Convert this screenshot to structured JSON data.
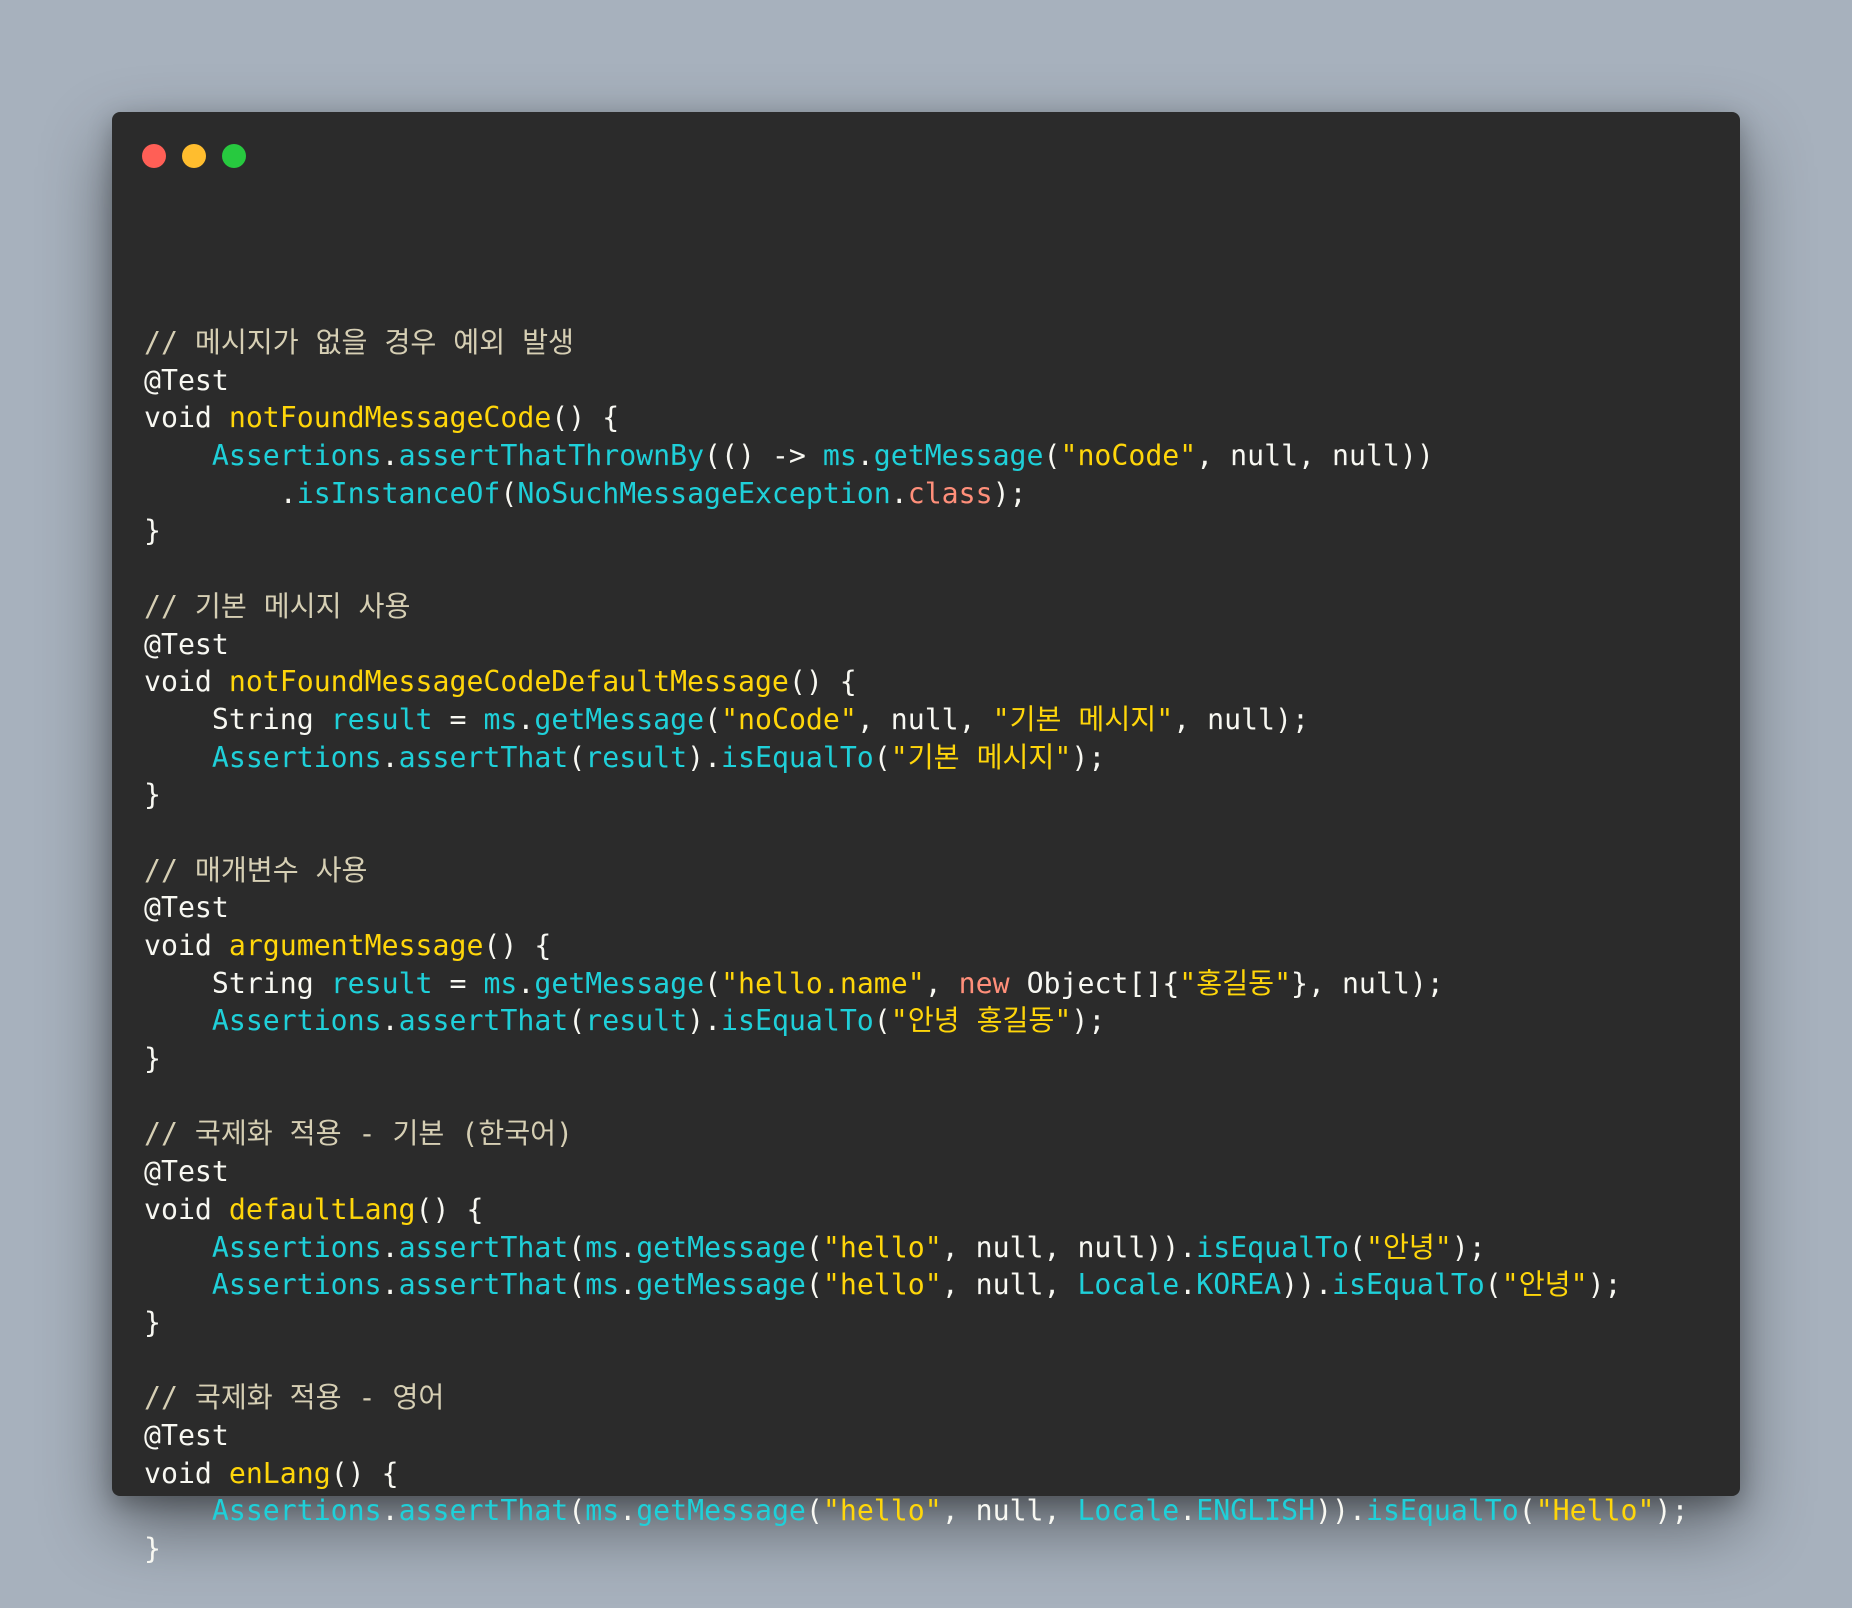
{
  "window": {
    "controls": [
      {
        "name": "close",
        "color": "#ff5f56"
      },
      {
        "name": "minimize",
        "color": "#ffbd2e"
      },
      {
        "name": "maximize",
        "color": "#27c93f"
      }
    ]
  },
  "colors": {
    "background": "#a7b1bd",
    "editor": "#2b2b2b",
    "comment": "#d6cfb4",
    "plain": "#f8f8f2",
    "function": "#ffd60a",
    "identifier": "#1fd0d9",
    "string": "#ffd60a",
    "keyword": "#ff8f7a"
  },
  "code": {
    "lines": [
      [
        {
          "t": "// 메시지가 없을 경우 예외 발생",
          "c": "comment"
        }
      ],
      [
        {
          "t": "@Test",
          "c": "plain"
        }
      ],
      [
        {
          "t": "void ",
          "c": "plain"
        },
        {
          "t": "notFoundMessageCode",
          "c": "fn"
        },
        {
          "t": "() {",
          "c": "plain"
        }
      ],
      [
        {
          "t": "    ",
          "c": "plain"
        },
        {
          "t": "Assertions",
          "c": "ident"
        },
        {
          "t": ".",
          "c": "plain"
        },
        {
          "t": "assertThatThrownBy",
          "c": "ident"
        },
        {
          "t": "(() -> ",
          "c": "plain"
        },
        {
          "t": "ms",
          "c": "ident"
        },
        {
          "t": ".",
          "c": "plain"
        },
        {
          "t": "getMessage",
          "c": "ident"
        },
        {
          "t": "(",
          "c": "plain"
        },
        {
          "t": "\"noCode\"",
          "c": "str"
        },
        {
          "t": ", null, null))",
          "c": "plain"
        }
      ],
      [
        {
          "t": "        .",
          "c": "plain"
        },
        {
          "t": "isInstanceOf",
          "c": "ident"
        },
        {
          "t": "(",
          "c": "plain"
        },
        {
          "t": "NoSuchMessageException",
          "c": "ident"
        },
        {
          "t": ".",
          "c": "plain"
        },
        {
          "t": "class",
          "c": "kw"
        },
        {
          "t": ");",
          "c": "plain"
        }
      ],
      [
        {
          "t": "}",
          "c": "plain"
        }
      ],
      [],
      [
        {
          "t": "// 기본 메시지 사용",
          "c": "comment"
        }
      ],
      [
        {
          "t": "@Test",
          "c": "plain"
        }
      ],
      [
        {
          "t": "void ",
          "c": "plain"
        },
        {
          "t": "notFoundMessageCodeDefaultMessage",
          "c": "fn"
        },
        {
          "t": "() {",
          "c": "plain"
        }
      ],
      [
        {
          "t": "    String ",
          "c": "plain"
        },
        {
          "t": "result",
          "c": "ident"
        },
        {
          "t": " = ",
          "c": "plain"
        },
        {
          "t": "ms",
          "c": "ident"
        },
        {
          "t": ".",
          "c": "plain"
        },
        {
          "t": "getMessage",
          "c": "ident"
        },
        {
          "t": "(",
          "c": "plain"
        },
        {
          "t": "\"noCode\"",
          "c": "str"
        },
        {
          "t": ", null, ",
          "c": "plain"
        },
        {
          "t": "\"기본 메시지\"",
          "c": "str"
        },
        {
          "t": ", null);",
          "c": "plain"
        }
      ],
      [
        {
          "t": "    ",
          "c": "plain"
        },
        {
          "t": "Assertions",
          "c": "ident"
        },
        {
          "t": ".",
          "c": "plain"
        },
        {
          "t": "assertThat",
          "c": "ident"
        },
        {
          "t": "(",
          "c": "plain"
        },
        {
          "t": "result",
          "c": "ident"
        },
        {
          "t": ").",
          "c": "plain"
        },
        {
          "t": "isEqualTo",
          "c": "ident"
        },
        {
          "t": "(",
          "c": "plain"
        },
        {
          "t": "\"기본 메시지\"",
          "c": "str"
        },
        {
          "t": ");",
          "c": "plain"
        }
      ],
      [
        {
          "t": "}",
          "c": "plain"
        }
      ],
      [],
      [
        {
          "t": "// 매개변수 사용",
          "c": "comment"
        }
      ],
      [
        {
          "t": "@Test",
          "c": "plain"
        }
      ],
      [
        {
          "t": "void ",
          "c": "plain"
        },
        {
          "t": "argumentMessage",
          "c": "fn"
        },
        {
          "t": "() {",
          "c": "plain"
        }
      ],
      [
        {
          "t": "    String ",
          "c": "plain"
        },
        {
          "t": "result",
          "c": "ident"
        },
        {
          "t": " = ",
          "c": "plain"
        },
        {
          "t": "ms",
          "c": "ident"
        },
        {
          "t": ".",
          "c": "plain"
        },
        {
          "t": "getMessage",
          "c": "ident"
        },
        {
          "t": "(",
          "c": "plain"
        },
        {
          "t": "\"hello.name\"",
          "c": "str"
        },
        {
          "t": ", ",
          "c": "plain"
        },
        {
          "t": "new",
          "c": "kw"
        },
        {
          "t": " Object[]{",
          "c": "plain"
        },
        {
          "t": "\"홍길동\"",
          "c": "str"
        },
        {
          "t": "}, null);",
          "c": "plain"
        }
      ],
      [
        {
          "t": "    ",
          "c": "plain"
        },
        {
          "t": "Assertions",
          "c": "ident"
        },
        {
          "t": ".",
          "c": "plain"
        },
        {
          "t": "assertThat",
          "c": "ident"
        },
        {
          "t": "(",
          "c": "plain"
        },
        {
          "t": "result",
          "c": "ident"
        },
        {
          "t": ").",
          "c": "plain"
        },
        {
          "t": "isEqualTo",
          "c": "ident"
        },
        {
          "t": "(",
          "c": "plain"
        },
        {
          "t": "\"안녕 홍길동\"",
          "c": "str"
        },
        {
          "t": ");",
          "c": "plain"
        }
      ],
      [
        {
          "t": "}",
          "c": "plain"
        }
      ],
      [],
      [
        {
          "t": "// 국제화 적용 - 기본 (한국어)",
          "c": "comment"
        }
      ],
      [
        {
          "t": "@Test",
          "c": "plain"
        }
      ],
      [
        {
          "t": "void ",
          "c": "plain"
        },
        {
          "t": "defaultLang",
          "c": "fn"
        },
        {
          "t": "() {",
          "c": "plain"
        }
      ],
      [
        {
          "t": "    ",
          "c": "plain"
        },
        {
          "t": "Assertions",
          "c": "ident"
        },
        {
          "t": ".",
          "c": "plain"
        },
        {
          "t": "assertThat",
          "c": "ident"
        },
        {
          "t": "(",
          "c": "plain"
        },
        {
          "t": "ms",
          "c": "ident"
        },
        {
          "t": ".",
          "c": "plain"
        },
        {
          "t": "getMessage",
          "c": "ident"
        },
        {
          "t": "(",
          "c": "plain"
        },
        {
          "t": "\"hello\"",
          "c": "str"
        },
        {
          "t": ", null, null)).",
          "c": "plain"
        },
        {
          "t": "isEqualTo",
          "c": "ident"
        },
        {
          "t": "(",
          "c": "plain"
        },
        {
          "t": "\"안녕\"",
          "c": "str"
        },
        {
          "t": ");",
          "c": "plain"
        }
      ],
      [
        {
          "t": "    ",
          "c": "plain"
        },
        {
          "t": "Assertions",
          "c": "ident"
        },
        {
          "t": ".",
          "c": "plain"
        },
        {
          "t": "assertThat",
          "c": "ident"
        },
        {
          "t": "(",
          "c": "plain"
        },
        {
          "t": "ms",
          "c": "ident"
        },
        {
          "t": ".",
          "c": "plain"
        },
        {
          "t": "getMessage",
          "c": "ident"
        },
        {
          "t": "(",
          "c": "plain"
        },
        {
          "t": "\"hello\"",
          "c": "str"
        },
        {
          "t": ", null, ",
          "c": "plain"
        },
        {
          "t": "Locale",
          "c": "ident"
        },
        {
          "t": ".",
          "c": "plain"
        },
        {
          "t": "KOREA",
          "c": "ident"
        },
        {
          "t": ")).",
          "c": "plain"
        },
        {
          "t": "isEqualTo",
          "c": "ident"
        },
        {
          "t": "(",
          "c": "plain"
        },
        {
          "t": "\"안녕\"",
          "c": "str"
        },
        {
          "t": ");",
          "c": "plain"
        }
      ],
      [
        {
          "t": "}",
          "c": "plain"
        }
      ],
      [],
      [
        {
          "t": "// 국제화 적용 - 영어",
          "c": "comment"
        }
      ],
      [
        {
          "t": "@Test",
          "c": "plain"
        }
      ],
      [
        {
          "t": "void ",
          "c": "plain"
        },
        {
          "t": "enLang",
          "c": "fn"
        },
        {
          "t": "() {",
          "c": "plain"
        }
      ],
      [
        {
          "t": "    ",
          "c": "plain"
        },
        {
          "t": "Assertions",
          "c": "ident"
        },
        {
          "t": ".",
          "c": "plain"
        },
        {
          "t": "assertThat",
          "c": "ident"
        },
        {
          "t": "(",
          "c": "plain"
        },
        {
          "t": "ms",
          "c": "ident"
        },
        {
          "t": ".",
          "c": "plain"
        },
        {
          "t": "getMessage",
          "c": "ident"
        },
        {
          "t": "(",
          "c": "plain"
        },
        {
          "t": "\"hello\"",
          "c": "str"
        },
        {
          "t": ", null, ",
          "c": "plain"
        },
        {
          "t": "Locale",
          "c": "ident"
        },
        {
          "t": ".",
          "c": "plain"
        },
        {
          "t": "ENGLISH",
          "c": "ident"
        },
        {
          "t": ")).",
          "c": "plain"
        },
        {
          "t": "isEqualTo",
          "c": "ident"
        },
        {
          "t": "(",
          "c": "plain"
        },
        {
          "t": "\"Hello\"",
          "c": "str"
        },
        {
          "t": ");",
          "c": "plain"
        }
      ],
      [
        {
          "t": "}",
          "c": "plain"
        }
      ]
    ]
  }
}
